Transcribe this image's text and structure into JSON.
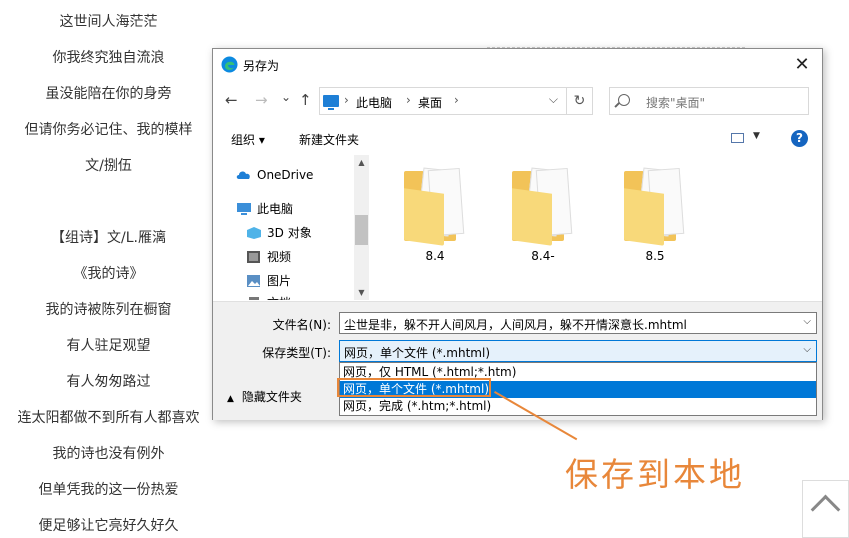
{
  "poem": [
    "这世间人海茫茫",
    "你我终究独自流浪",
    "虽没能陪在你的身旁",
    "但请你务必记住、我的模样",
    "文/捌伍",
    "【组诗】文/L.雁漓",
    "《我的诗》",
    "我的诗被陈列在橱窗",
    "有人驻足观望",
    "有人匆匆路过",
    "连太阳都做不到所有人都喜欢",
    "我的诗也没有例外",
    "但单凭我的这一份热爱",
    "便足够让它亮好久好久"
  ],
  "dialog": {
    "title": "另存为",
    "close": "✕",
    "nav": {
      "back": "←",
      "forward": "→",
      "recent": "⌄",
      "up": "↑",
      "refresh": "↻"
    },
    "breadcrumb": [
      "此电脑",
      "桌面"
    ],
    "search_placeholder": "搜索\"桌面\"",
    "toolbar": {
      "organize": "组织 ▾",
      "new_folder": "新建文件夹",
      "view_dd": "▼",
      "help": "?"
    },
    "nav_items": [
      {
        "label": "OneDrive",
        "icon": "cloud-icon"
      },
      {
        "label": "此电脑",
        "icon": "computer-icon"
      },
      {
        "label": "3D 对象",
        "icon": "cube-icon"
      },
      {
        "label": "视频",
        "icon": "video-icon"
      },
      {
        "label": "图片",
        "icon": "picture-icon"
      },
      {
        "label": "文档",
        "icon": "document-icon"
      }
    ],
    "folders": [
      "8.4",
      "8.4-",
      "8.5"
    ],
    "filename_label": "文件名(N):",
    "filename_value": "尘世是非，躲不开人间风月，人间风月，躲不开情深意长.mhtml",
    "filetype_label": "保存类型(T):",
    "filetype_value": "网页，单个文件 (*.mhtml)",
    "filetype_options": [
      "网页，仅 HTML (*.html;*.htm)",
      "网页，单个文件 (*.mhtml)",
      "网页，完成 (*.htm;*.html)"
    ],
    "hide_folders": "隐藏文件夹",
    "dropdown_caret": "⌵"
  },
  "annotation": "保存到本地",
  "colors": {
    "accent": "#0078d7",
    "annotation": "#e8873a",
    "folder": "#f2c358"
  }
}
